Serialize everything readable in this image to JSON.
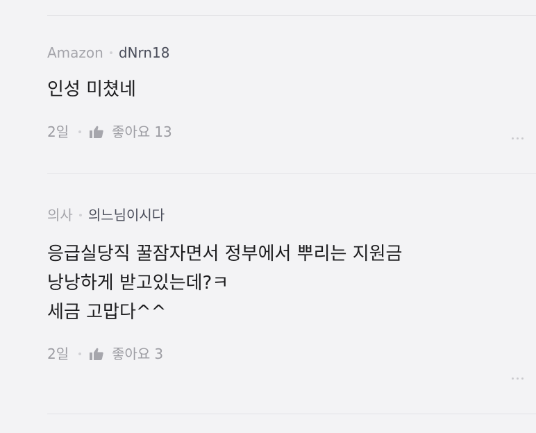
{
  "comments": [
    {
      "company": "Amazon",
      "nickname": "dNrn18",
      "lines": [
        "인성 미쳤네"
      ],
      "time": "2일",
      "like_label": "좋아요",
      "like_count": "13",
      "more_icon": "more-horizontal-icon"
    },
    {
      "company": "의사",
      "nickname": "의느님이시다",
      "lines": [
        "응급실당직 꿀잠자면서 정부에서 뿌리는 지원금",
        "낭낭하게 받고있는데?ㅋ",
        "세금 고맙다^^"
      ],
      "time": "2일",
      "like_label": "좋아요",
      "like_count": "3",
      "more_icon": "more-horizontal-icon"
    }
  ],
  "colors": {
    "background": "#f3f3f5",
    "text_primary": "#1c1c1e",
    "text_secondary": "#9c9ca2",
    "nickname": "#4a4d5a",
    "divider": "#e2e2e6"
  }
}
